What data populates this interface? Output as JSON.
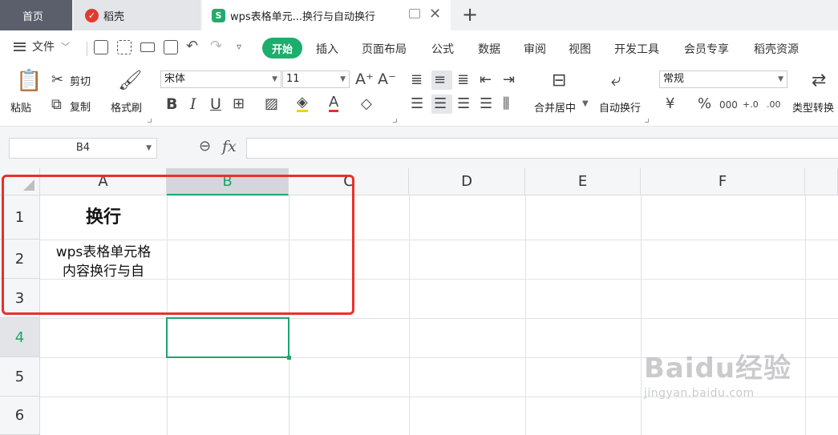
{
  "tabs": {
    "home": "首页",
    "daoke": "稻壳",
    "doc": "wps表格单元...换行与自动换行",
    "doc_logo": "S"
  },
  "menu": {
    "file": "文件",
    "start": "开始",
    "items": [
      "插入",
      "页面布局",
      "公式",
      "数据",
      "审阅",
      "视图",
      "开发工具",
      "会员专享",
      "稻壳资源"
    ]
  },
  "ribbon": {
    "paste": "粘贴",
    "cut": "剪切",
    "copy": "复制",
    "format_painter": "格式刷",
    "font_name": "宋体",
    "font_size": "11",
    "merge_center": "合并居中",
    "wrap_text": "自动换行",
    "number_format": "常规",
    "type_convert": "类型转换"
  },
  "formula_bar": {
    "name_box": "B4",
    "fx": "fx",
    "content": ""
  },
  "grid": {
    "columns": [
      "A",
      "B",
      "C",
      "D",
      "E",
      "F"
    ],
    "rows": [
      "1",
      "2",
      "3",
      "4",
      "5",
      "6"
    ],
    "selected_column": "B",
    "selected_row": "4",
    "cells": {
      "A1": "换行",
      "A2_line1": "wps表格单元格",
      "A2_line2": "内容换行与自"
    }
  },
  "watermark": {
    "main": "Baidu经验",
    "sub": "jingyan.baidu.com"
  },
  "colors": {
    "accent": "#1bae6c",
    "highlight_border": "#e8312a",
    "home_tab": "#5a5f6b"
  }
}
